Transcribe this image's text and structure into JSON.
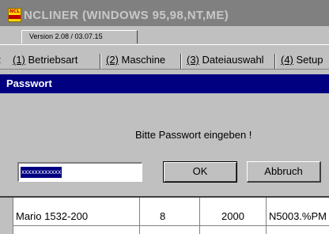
{
  "app": {
    "title": "NCLINER (WINDOWS 95,98,NT,ME)",
    "icon_text": "NCL"
  },
  "version": {
    "label": "Version 2.08 / 03.07.15"
  },
  "tabs": [
    {
      "key": "(1)",
      "label": "Betriebsart"
    },
    {
      "key": "(2)",
      "label": "Maschine"
    },
    {
      "key": "(3)",
      "label": "Dateiauswahl"
    },
    {
      "key": "(4)",
      "label": "Setup"
    }
  ],
  "dialog": {
    "title": "Passwort",
    "message": "Bitte Passwort eingeben !",
    "password_value": "xxxxxxxxxxxx",
    "ok_label": "OK",
    "cancel_label": "Abbruch"
  },
  "table": {
    "row_cells": [
      "Mario 1532-200",
      "8",
      "2000",
      "N5003.%PM"
    ]
  }
}
